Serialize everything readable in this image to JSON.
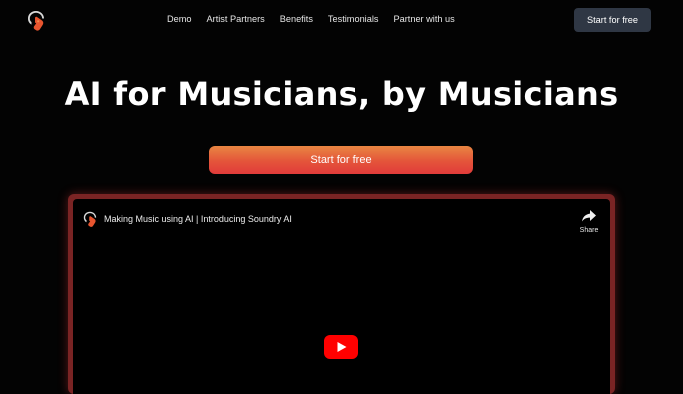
{
  "nav": {
    "links": [
      "Demo",
      "Artist Partners",
      "Benefits",
      "Testimonials",
      "Partner with us"
    ],
    "cta_label": "Start for free",
    "logo_icon": "soundry-logo-icon"
  },
  "hero": {
    "title": "AI for Musicians, by Musicians",
    "cta_label": "Start for free"
  },
  "video": {
    "title": "Making Music using AI | Introducing Soundry AI",
    "share_label": "Share",
    "share_icon": "share-arrow-icon",
    "play_icon": "youtube-play-icon"
  },
  "colors": {
    "background": "#030303",
    "nav_cta_bg": "#2f3744",
    "cta_gradient_top": "#e98642",
    "cta_gradient_bottom": "#e13b3a",
    "video_border": "#7a2424",
    "youtube_red": "#ff0000"
  }
}
